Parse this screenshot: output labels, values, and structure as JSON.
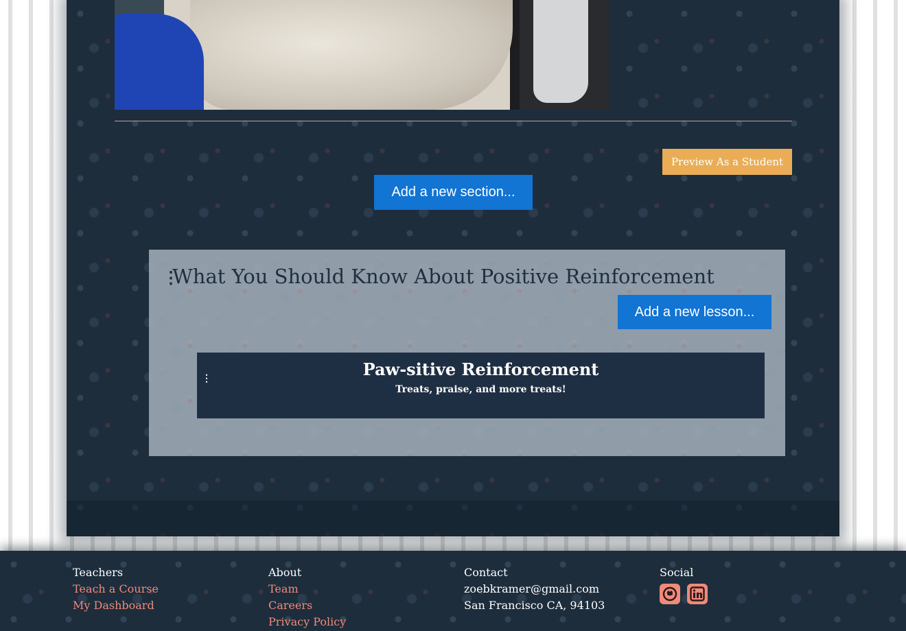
{
  "main": {
    "preview_button": "Preview As a Student",
    "add_section_button": "Add a new section...",
    "section": {
      "title": "What You Should Know About Positive Reinforcement",
      "add_lesson_button": "Add a new lesson...",
      "lessons": [
        {
          "title": "Paw-sitive Reinforcement",
          "subtitle": "Treats, praise, and more treats!"
        }
      ]
    }
  },
  "footer": {
    "teachers": {
      "heading": "Teachers",
      "links": [
        "Teach a Course",
        "My Dashboard"
      ]
    },
    "about": {
      "heading": "About",
      "links": [
        "Team",
        "Careers",
        "Privacy Policy"
      ]
    },
    "contact": {
      "heading": "Contact",
      "lines": [
        "zoebkramer@gmail.com",
        "San Francisco CA, 94103"
      ]
    },
    "social": {
      "heading": "Social",
      "icons": [
        "github-icon",
        "linkedin-icon"
      ]
    }
  },
  "colors": {
    "panel_bg": "#1d2d3c",
    "primary_button": "#1274d3",
    "preview_button": "#eaad55",
    "link": "#f08a7a",
    "lesson_card": "#1f2f43"
  }
}
